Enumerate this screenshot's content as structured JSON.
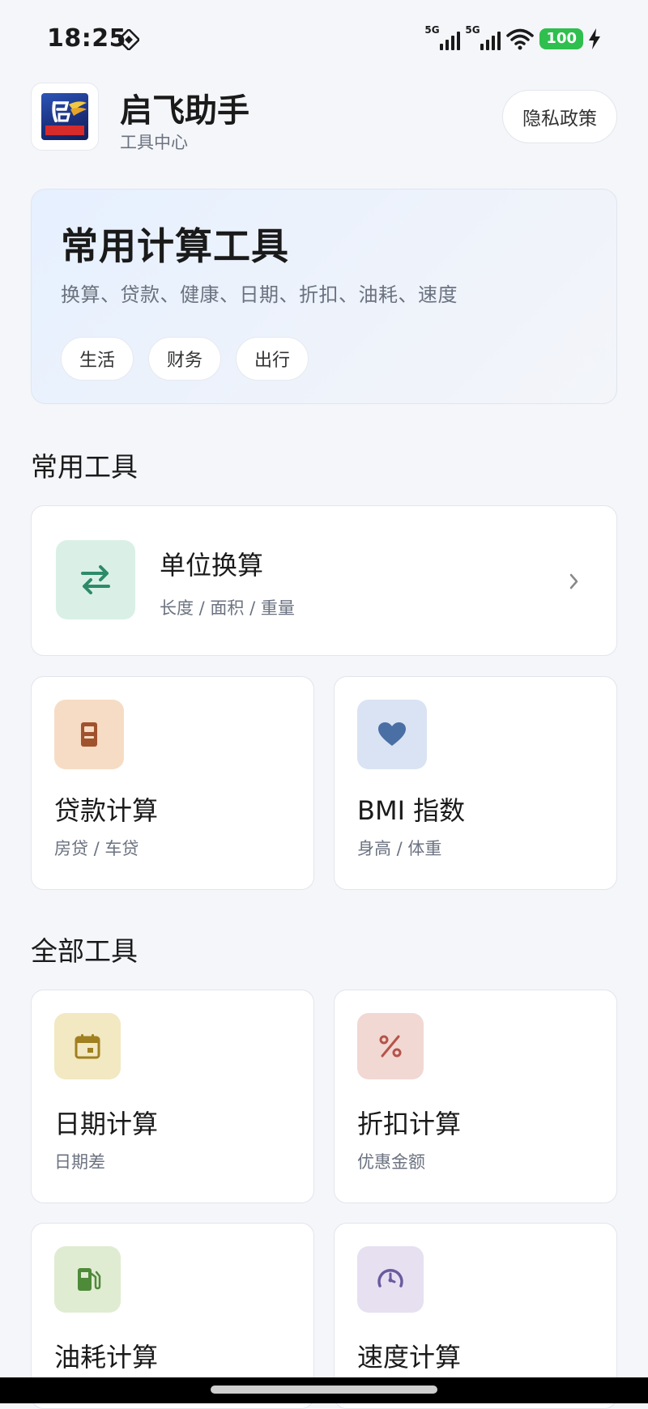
{
  "status_bar": {
    "time": "18:25",
    "signal1_label": "5G",
    "signal2_label": "5G",
    "battery": "100"
  },
  "header": {
    "app_title": "启飞助手",
    "app_subtitle": "工具中心",
    "privacy_label": "隐私政策"
  },
  "banner": {
    "title": "常用计算工具",
    "subtitle": "换算、贷款、健康、日期、折扣、油耗、速度",
    "chips": [
      "生活",
      "财务",
      "出行"
    ]
  },
  "sections": {
    "common": "常用工具",
    "all": "全部工具"
  },
  "tools": {
    "unit": {
      "title": "单位换算",
      "desc": "长度 / 面积 / 重量",
      "icon": "swap-arrows-icon",
      "color": "#2e8b6a"
    },
    "loan": {
      "title": "贷款计算",
      "desc": "房贷 / 车贷",
      "icon": "calculator-icon",
      "color": "#a0522d"
    },
    "bmi": {
      "title": "BMI 指数",
      "desc": "身高 / 体重",
      "icon": "heart-icon",
      "color": "#4a6fa5"
    },
    "date": {
      "title": "日期计算",
      "desc": "日期差",
      "icon": "calendar-icon",
      "color": "#a0801f"
    },
    "discount": {
      "title": "折扣计算",
      "desc": "优惠金额",
      "icon": "percent-icon",
      "color": "#b5544a"
    },
    "fuel": {
      "title": "油耗计算",
      "icon": "fuel-icon",
      "color": "#4f8a3a"
    },
    "speed": {
      "title": "速度计算",
      "icon": "speedometer-icon",
      "color": "#6a5a9e"
    }
  }
}
